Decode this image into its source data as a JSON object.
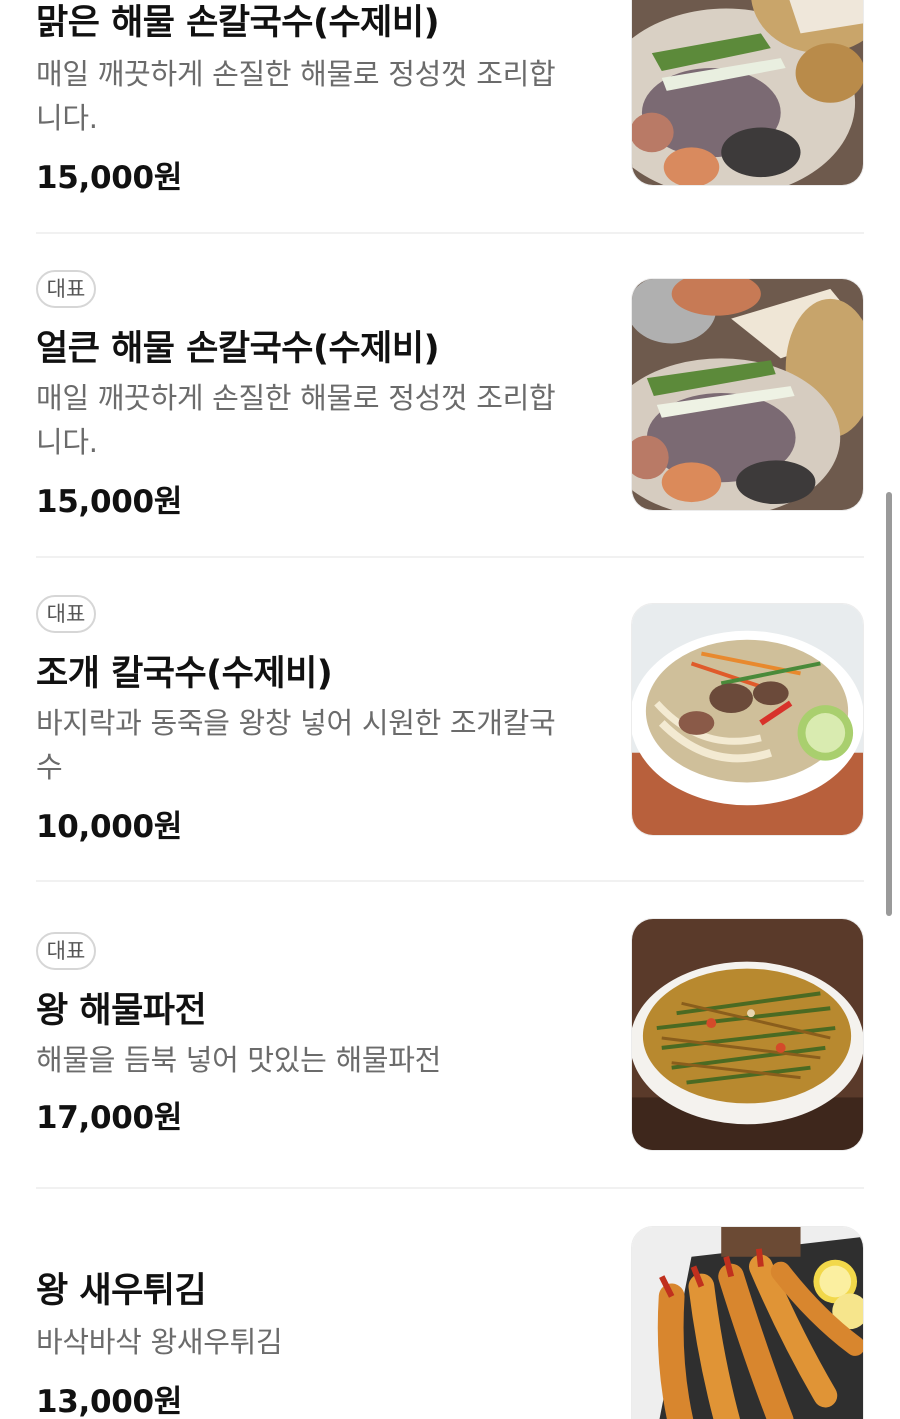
{
  "menu_items": [
    {
      "badge": "",
      "name": "맑은 해물 손칼국수(수제비)",
      "description": "매일 깨끗하게 손질한 해물로 정성껏 조리합니다.",
      "price": "15,000원",
      "photo": "seafood-platter-photo"
    },
    {
      "badge": "대표",
      "name": "얼큰 해물 손칼국수(수제비)",
      "description": "매일 깨끗하게 손질한 해물로 정성껏 조리합니다.",
      "price": "15,000원",
      "photo": "seafood-platter-photo"
    },
    {
      "badge": "대표",
      "name": "조개 칼국수(수제비)",
      "description": "바지락과 동죽을 왕창 넣어 시원한 조개칼국수",
      "price": "10,000원",
      "photo": "clam-noodle-soup-photo"
    },
    {
      "badge": "대표",
      "name": "왕 해물파전",
      "description": "해물을 듬북 넣어 맛있는 해물파전",
      "price": "17,000원",
      "photo": "seafood-pancake-photo"
    },
    {
      "badge": "",
      "name": "왕 새우튀김",
      "description": "바삭바삭 왕새우튀김",
      "price": "13,000원",
      "photo": "fried-shrimp-photo"
    }
  ],
  "colors": {
    "text_primary": "#111111",
    "text_secondary": "#6b6b6b",
    "divider": "#f1f1f1",
    "badge_border": "#d6d6d6"
  }
}
